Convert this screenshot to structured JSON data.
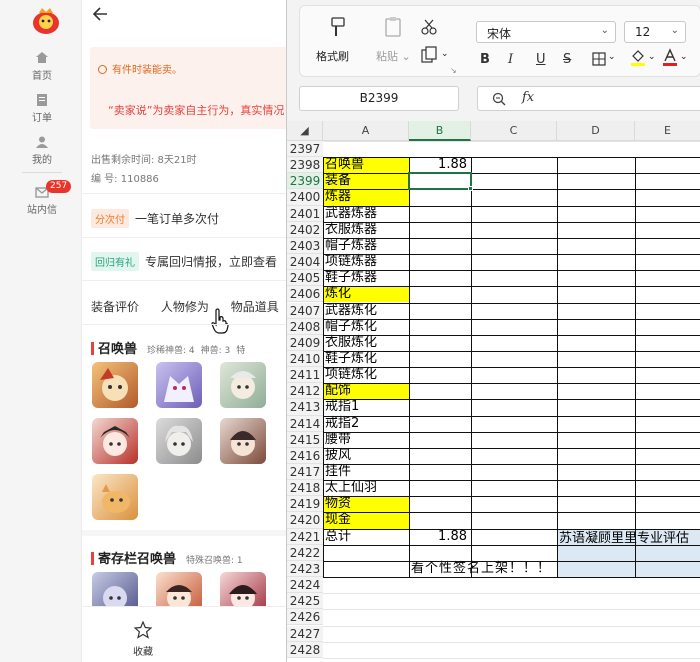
{
  "left_nav": {
    "items": [
      {
        "label": "首页",
        "icon": "home-icon"
      },
      {
        "label": "订单",
        "icon": "order-icon"
      },
      {
        "label": "我的",
        "icon": "user-icon"
      },
      {
        "label": "站内信",
        "icon": "mail-icon"
      }
    ],
    "mail_badge": "257"
  },
  "product": {
    "notice_line1": "有件时装能卖。",
    "notice_line2": "“卖家说”为卖家自主行为，真实情况",
    "sale_time": "出售剩余时间: 8天21时",
    "serial": "编 号: 110886",
    "pay_tag": "分次付",
    "pay_text": "一笔订单多次付",
    "return_tag": "回归有礼",
    "return_text": "专属回归情报，立即查看",
    "tabs": [
      "装备评价",
      "人物修为",
      "物品道具"
    ],
    "summon_section": {
      "title": "召唤兽",
      "stats": [
        "珍稀神兽: 4",
        "神兽: 3",
        "特"
      ]
    },
    "storage_section": {
      "title": "寄存栏召唤兽",
      "stats": [
        "特殊召唤兽: 1"
      ]
    },
    "bottom_label": "收藏"
  },
  "ribbon": {
    "format_painter": "格式刷",
    "paste": "粘贴",
    "font_name": "宋体",
    "font_size": "12",
    "format_buttons": [
      "B",
      "I",
      "U",
      "S"
    ]
  },
  "name_box": "B2399",
  "formula_fx": "fx",
  "columns": [
    "A",
    "B",
    "C",
    "D",
    "E"
  ],
  "rows": [
    {
      "n": "2397",
      "a": "",
      "b": "",
      "hl": false
    },
    {
      "n": "2398",
      "a": "召唤兽",
      "b": "1.88",
      "hl": true
    },
    {
      "n": "2399",
      "a": "装备",
      "b": "",
      "hl": true
    },
    {
      "n": "2400",
      "a": "炼器",
      "b": "",
      "hl": true
    },
    {
      "n": "2401",
      "a": "武器炼器",
      "b": "",
      "hl": false
    },
    {
      "n": "2402",
      "a": "衣服炼器",
      "b": "",
      "hl": false
    },
    {
      "n": "2403",
      "a": "帽子炼器",
      "b": "",
      "hl": false
    },
    {
      "n": "2404",
      "a": "项链炼器",
      "b": "",
      "hl": false
    },
    {
      "n": "2405",
      "a": "鞋子炼器",
      "b": "",
      "hl": false
    },
    {
      "n": "2406",
      "a": "炼化",
      "b": "",
      "hl": true
    },
    {
      "n": "2407",
      "a": "武器炼化",
      "b": "",
      "hl": false
    },
    {
      "n": "2408",
      "a": "帽子炼化",
      "b": "",
      "hl": false
    },
    {
      "n": "2409",
      "a": "衣服炼化",
      "b": "",
      "hl": false
    },
    {
      "n": "2410",
      "a": "鞋子炼化",
      "b": "",
      "hl": false
    },
    {
      "n": "2411",
      "a": "项链炼化",
      "b": "",
      "hl": false
    },
    {
      "n": "2412",
      "a": "配饰",
      "b": "",
      "hl": true
    },
    {
      "n": "2413",
      "a": "戒指1",
      "b": "",
      "hl": false
    },
    {
      "n": "2414",
      "a": "戒指2",
      "b": "",
      "hl": false
    },
    {
      "n": "2415",
      "a": "腰带",
      "b": "",
      "hl": false
    },
    {
      "n": "2416",
      "a": "披风",
      "b": "",
      "hl": false
    },
    {
      "n": "2417",
      "a": "挂件",
      "b": "",
      "hl": false
    },
    {
      "n": "2418",
      "a": "太上仙羽",
      "b": "",
      "hl": false
    },
    {
      "n": "2419",
      "a": "物资",
      "b": "",
      "hl": true
    },
    {
      "n": "2420",
      "a": "现金",
      "b": "",
      "hl": true
    },
    {
      "n": "2421",
      "a": "总计",
      "b": "1.88",
      "hl": false
    },
    {
      "n": "2422",
      "a": "",
      "b": "",
      "hl": false
    },
    {
      "n": "2423",
      "a": "",
      "b": "",
      "hl": false
    },
    {
      "n": "2424",
      "a": "",
      "b": "",
      "hl": false
    },
    {
      "n": "2425",
      "a": "",
      "b": "",
      "hl": false
    },
    {
      "n": "2426",
      "a": "",
      "b": "",
      "hl": false
    },
    {
      "n": "2427",
      "a": "",
      "b": "",
      "hl": false
    },
    {
      "n": "2428",
      "a": "",
      "b": "",
      "hl": false
    }
  ],
  "evaluator_note": "苏语凝顾里里专业评估",
  "signature_note": "看个性签名上架！！！",
  "colors": {
    "highlight": "#ffff00",
    "merged_fill": "#dce9f5",
    "selection": "#217346",
    "accent_red": "#e8423a"
  }
}
